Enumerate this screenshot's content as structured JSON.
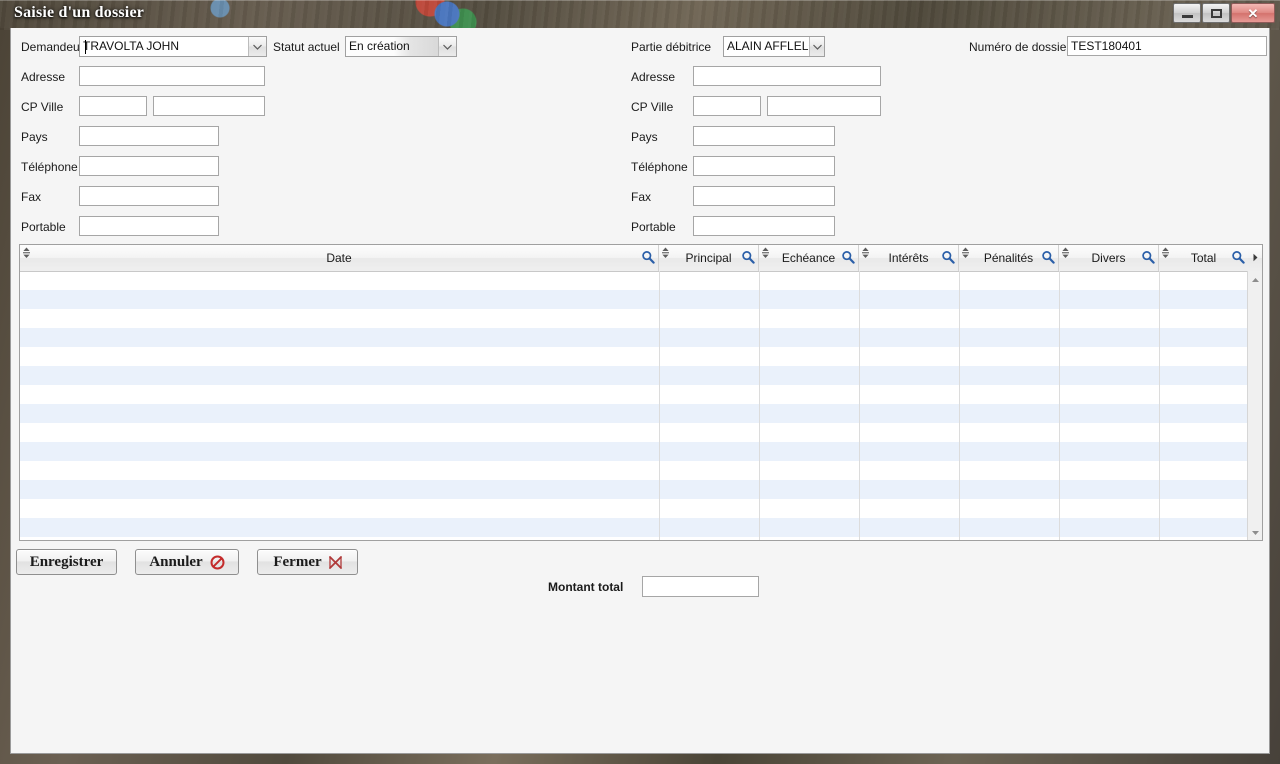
{
  "window": {
    "title": "Saisie d'un dossier",
    "controls": [
      {
        "name": "minimize",
        "label": "Réduire",
        "glyph": "minimize-icon"
      },
      {
        "name": "maximize",
        "label": "Agrandir",
        "glyph": "maximize-icon"
      },
      {
        "name": "close",
        "label": "Fermer",
        "glyph": "close-icon"
      }
    ]
  },
  "form": {
    "demandeur": {
      "label": "Demandeur",
      "value": "TRAVOLTA JOHN"
    },
    "statut": {
      "label": "Statut actuel",
      "value": "En création"
    },
    "partie_debitrice": {
      "label": "Partie débitrice",
      "value": "ALAIN AFFLELOU"
    },
    "numero_dossier": {
      "label": "Numéro de dossier",
      "value": "TEST180401"
    },
    "left_fields": [
      {
        "label": "Adresse",
        "value": "",
        "placeholder": ""
      },
      {
        "label": "CP Ville",
        "value": "",
        "placeholder": ""
      },
      {
        "label": "Pays",
        "value": "",
        "placeholder": ""
      },
      {
        "label": "Téléphone",
        "value": "",
        "placeholder": ""
      },
      {
        "label": "Fax",
        "value": "",
        "placeholder": ""
      },
      {
        "label": "Portable",
        "value": "",
        "placeholder": ""
      }
    ],
    "right_fields": [
      {
        "label": "Adresse",
        "value": "",
        "placeholder": ""
      },
      {
        "label": "CP Ville",
        "value": "",
        "placeholder": ""
      },
      {
        "label": "Pays",
        "value": "",
        "placeholder": ""
      },
      {
        "label": "Téléphone",
        "value": "",
        "placeholder": ""
      },
      {
        "label": "Fax",
        "value": "",
        "placeholder": ""
      },
      {
        "label": "Portable",
        "value": "",
        "placeholder": ""
      }
    ],
    "cp_ville_left": {
      "cp": "",
      "ville": ""
    },
    "cp_ville_right": {
      "cp": "",
      "ville": ""
    }
  },
  "grid": {
    "columns": [
      {
        "label": "Date",
        "icon": "search-icon",
        "sort": "sort-icon"
      },
      {
        "label": "Principal",
        "icon": "search-icon",
        "sort": "sort-icon"
      },
      {
        "label": "Echéance",
        "icon": "search-icon",
        "sort": "sort-icon"
      },
      {
        "label": "Intérêts",
        "icon": "search-icon",
        "sort": "sort-icon"
      },
      {
        "label": "Pénalités",
        "icon": "search-icon",
        "sort": "sort-icon"
      },
      {
        "label": "Divers",
        "icon": "search-icon",
        "sort": "sort-icon"
      },
      {
        "label": "Total",
        "icon": "search-icon",
        "sort": "sort-icon"
      }
    ],
    "rows": [],
    "row_count_visible": 14,
    "scroll_right_icon": "chevron-right-icon",
    "scroll_up_icon": "chevron-up-icon",
    "scroll_down_icon": "chevron-down-icon"
  },
  "footer": {
    "buttons": [
      {
        "label": "Enregistrer",
        "icon": null
      },
      {
        "label": "Annuler",
        "icon": "no-entry-icon"
      },
      {
        "label": "Fermer",
        "icon": "close-x-icon"
      }
    ],
    "montant_total": {
      "label": "Montant total",
      "value": ""
    }
  },
  "colors": {
    "accent_blue": "#2b5fa8",
    "row_alt": "#eaf1fb",
    "window_bg": "#f5f5f5",
    "danger_red": "#c42b2b"
  }
}
